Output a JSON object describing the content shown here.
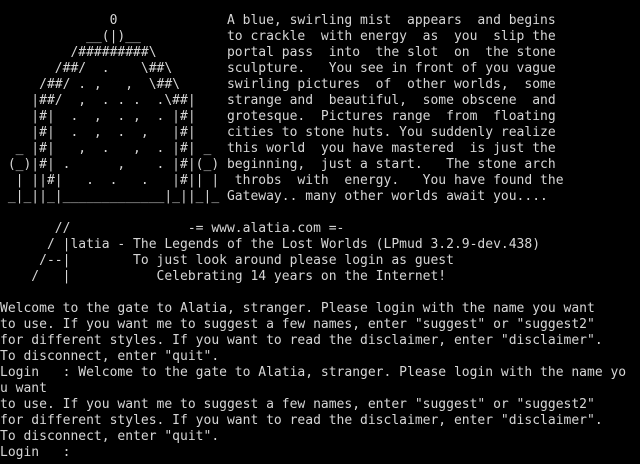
{
  "terminal": {
    "fg_color": "#d6d6d6",
    "bg_color": "#000000",
    "lines": [
      "              0              A blue, swirling mist  appears  and begins",
      "           __(|)__           to crackle  with energy  as  you  slip the",
      "         /#########\\         portal pass  into  the slot  on  the stone",
      "       /##/  .    \\##\\       sculpture.   You see in front of you vague",
      "     /##/ . ,   ,  \\##\\      swirling pictures  of  other worlds,  some",
      "    |##/  ,  . . .  .\\##|    strange and  beautiful,  some obscene  and",
      "    |#|  .  ,  . ,  . |#|    grotesque.  Pictures range  from  floating",
      "    |#|  .  ,  .  ,   |#|    cities to stone huts. You suddenly realize",
      "  _ |#|   ,  .   ,  . |#| _  this world  you have mastered  is just the",
      " (_)|#| .      ,    . |#|(_) beginning,  just a start.   The stone arch",
      "  | ||#|   .  .   .   |#|| |  throbs  with  energy.   You have found the",
      " _|_||_|_____________|_||_|_ Gateway.. many other worlds await you....",
      "",
      "       //               -= www.alatia.com =-",
      "      / |latia - The Legends of the Lost Worlds (LPmud 3.2.9-dev.438)",
      "     /--|        To just look around please login as guest",
      "    /   |           Celebrating 14 years on the Internet!",
      "",
      "Welcome to the gate to Alatia, stranger. Please login with the name you want",
      "to use. If you want me to suggest a few names, enter \"suggest\" or \"suggest2\"",
      "for different styles. If you want to read the disclaimer, enter \"disclaimer\".",
      "To disconnect, enter \"quit\".",
      "Login   : Welcome to the gate to Alatia, stranger. Please login with the name yo",
      "u want",
      "to use. If you want me to suggest a few names, enter \"suggest\" or \"suggest2\"",
      "for different styles. If you want to read the disclaimer, enter \"disclaimer\".",
      "To disconnect, enter \"quit\".",
      "Login   :"
    ]
  }
}
